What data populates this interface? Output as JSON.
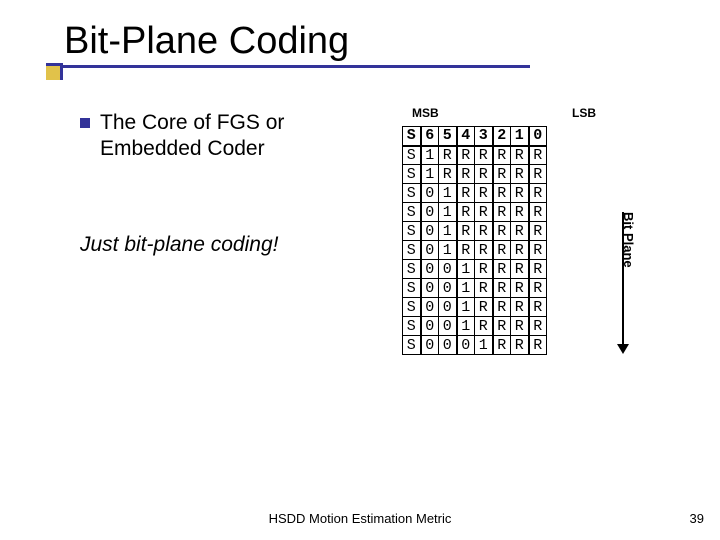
{
  "title": "Bit-Plane Coding",
  "bullet": "The Core of FGS or Embedded Coder",
  "italic_line": "Just bit-plane coding!",
  "msb_label": "MSB",
  "lsb_label": "LSB",
  "bit_plane_label": "Bit Plane",
  "footer": "HSDD Motion Estimation Metric",
  "page_number": "39",
  "table": {
    "header": [
      "S",
      "6",
      "5",
      "4",
      "3",
      "2",
      "1",
      "0"
    ],
    "rows": [
      [
        "S",
        "1",
        "R",
        "R",
        "R",
        "R",
        "R",
        "R"
      ],
      [
        "S",
        "1",
        "R",
        "R",
        "R",
        "R",
        "R",
        "R"
      ],
      [
        "S",
        "0",
        "1",
        "R",
        "R",
        "R",
        "R",
        "R"
      ],
      [
        "S",
        "0",
        "1",
        "R",
        "R",
        "R",
        "R",
        "R"
      ],
      [
        "S",
        "0",
        "1",
        "R",
        "R",
        "R",
        "R",
        "R"
      ],
      [
        "S",
        "0",
        "1",
        "R",
        "R",
        "R",
        "R",
        "R"
      ],
      [
        "S",
        "0",
        "0",
        "1",
        "R",
        "R",
        "R",
        "R"
      ],
      [
        "S",
        "0",
        "0",
        "1",
        "R",
        "R",
        "R",
        "R"
      ],
      [
        "S",
        "0",
        "0",
        "1",
        "R",
        "R",
        "R",
        "R"
      ],
      [
        "S",
        "0",
        "0",
        "1",
        "R",
        "R",
        "R",
        "R"
      ],
      [
        "S",
        "0",
        "0",
        "0",
        "1",
        "R",
        "R",
        "R"
      ]
    ]
  }
}
